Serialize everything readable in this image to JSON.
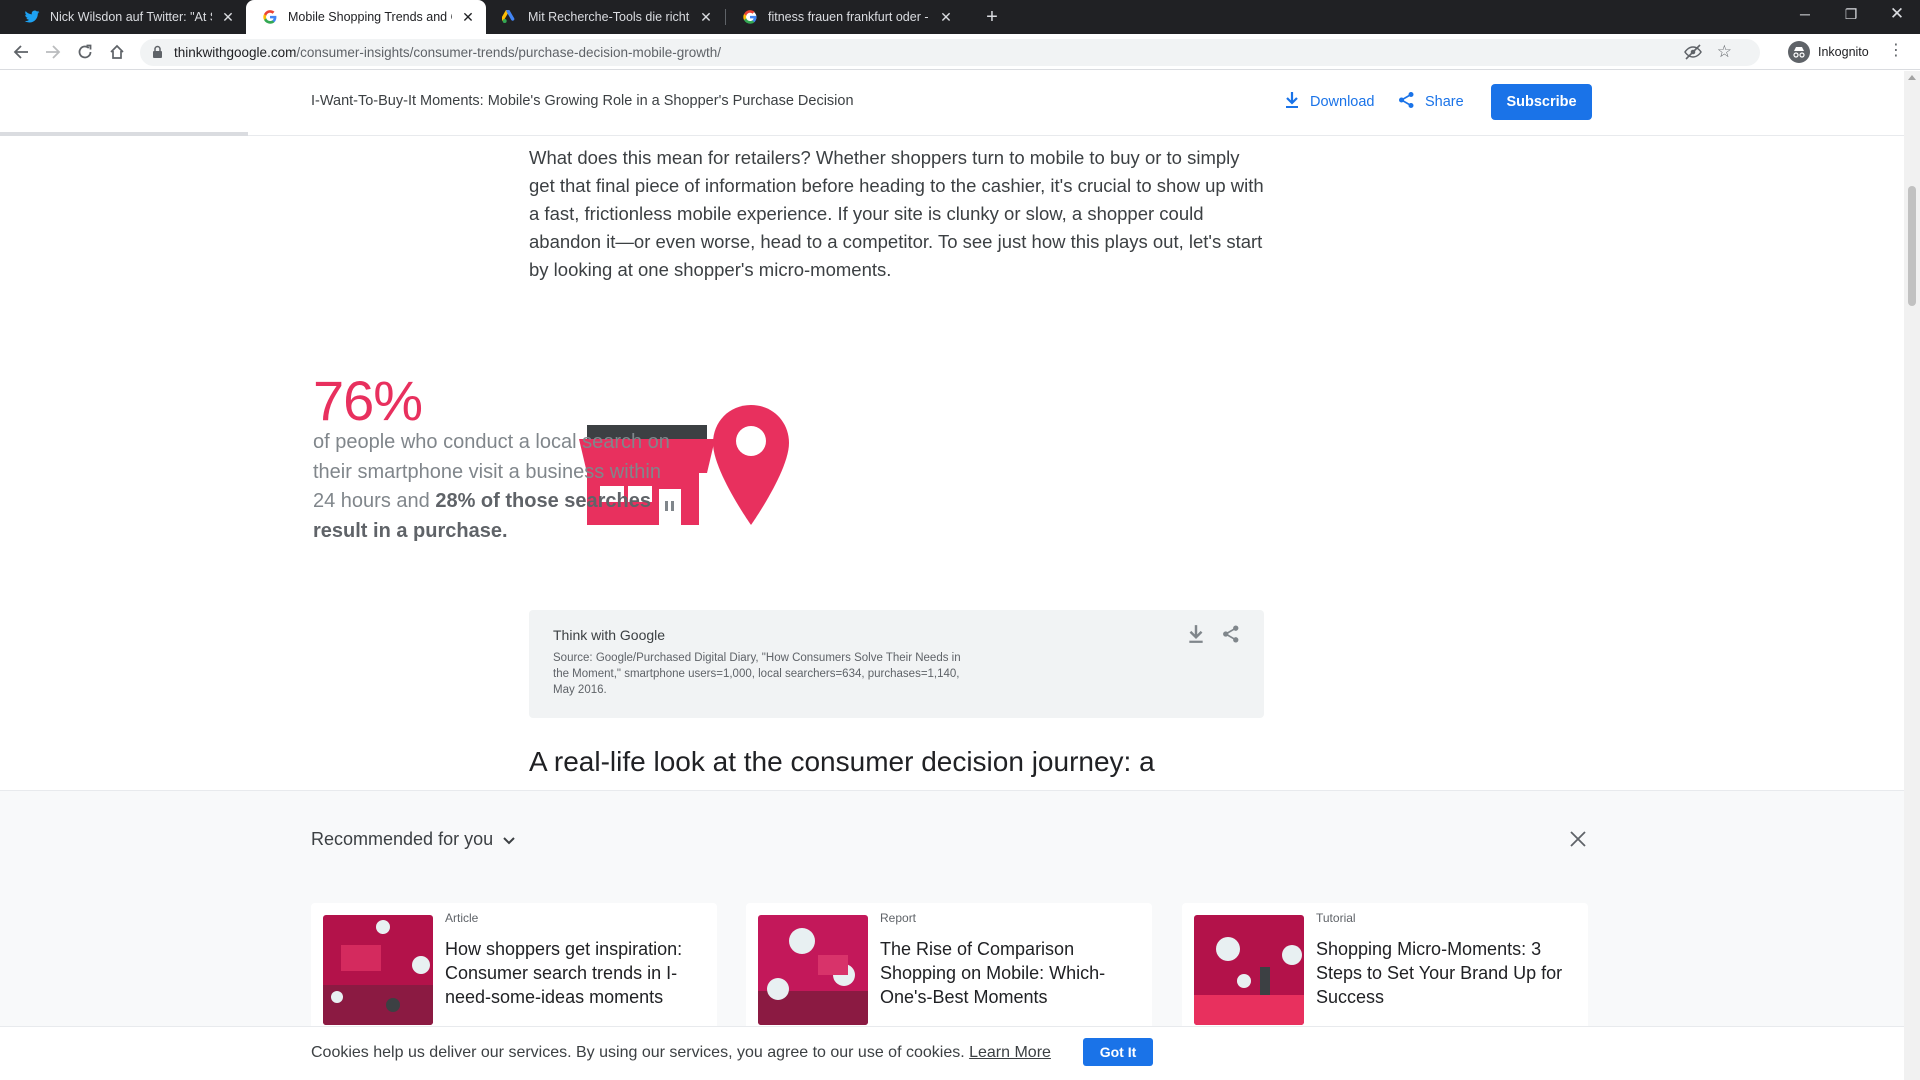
{
  "browser": {
    "tabs": [
      {
        "title": "Nick Wilsdon auf Twitter: \"At Sea",
        "icon": "twitter-icon",
        "active": false
      },
      {
        "title": "Mobile Shopping Trends and Con",
        "icon": "google-icon",
        "active": true
      },
      {
        "title": "Mit Recherche-Tools die richtigen",
        "icon": "google-ads-icon",
        "active": false
      },
      {
        "title": "fitness frauen frankfurt oder - Go",
        "icon": "google-icon",
        "active": false
      }
    ],
    "new_tab_label": "+",
    "url_host": "thinkwithgoogle.com",
    "url_path": "/consumer-insights/consumer-trends/purchase-decision-mobile-growth/",
    "profile_label": "Inkognito"
  },
  "header": {
    "article_title": "I-Want-To-Buy-It Moments: Mobile's Growing Role in a Shopper's Purchase Decision",
    "download_label": "Download",
    "share_label": "Share",
    "subscribe_label": "Subscribe",
    "reading_progress": 0.13
  },
  "article": {
    "paragraph": "What does this mean for retailers? Whether shoppers turn to mobile to buy or to simply get that final piece of information before heading to the cashier, it's crucial to show up with a fast, frictionless mobile experience. If your site is clunky or slow, a shopper could abandon it—or even worse, head to a competitor. To see just how this plays out, let's start by looking at one shopper's micro-moments.",
    "stat": {
      "value": "76%",
      "text_plain": "of people who conduct a local search on their smartphone visit a business within 24 hours and ",
      "text_bold": "28% of those searches result in a purchase."
    },
    "source_brand": "Think with Google",
    "source_text": "Source: Google/Purchased Digital Diary, \"How Consumers Solve Their Needs in the Moment,\" smartphone users=1,000, local searchers=634, purchases=1,140, May 2016.",
    "next_heading": "A real-life look at the consumer decision journey: a"
  },
  "recommended": {
    "title": "Recommended for you",
    "cards": [
      {
        "kind": "Article",
        "title": "How shoppers get inspiration: Consumer search trends in I-need-some-ideas moments"
      },
      {
        "kind": "Report",
        "title": "The Rise of Comparison Shopping on Mobile: Which-One's-Best Moments"
      },
      {
        "kind": "Tutorial",
        "title": "Shopping Micro-Moments: 3 Steps to Set Your Brand Up for Success"
      }
    ]
  },
  "cookie": {
    "message": "Cookies help us deliver our services. By using our services, you agree to our use of cookies.",
    "learn_more": "Learn More",
    "accept_label": "Got It"
  },
  "colors": {
    "accent_blue": "#1a73e8",
    "brand_pink": "#e8305e",
    "dark_magenta": "#8b1a42"
  }
}
